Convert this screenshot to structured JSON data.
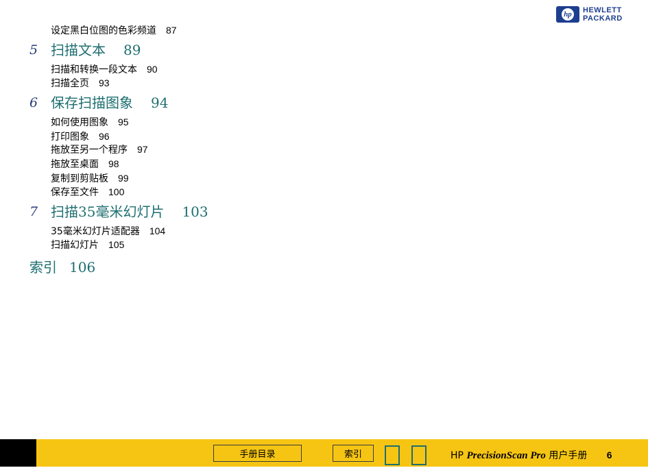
{
  "logo": {
    "line1": "HEWLETT",
    "line2": "PACKARD",
    "mark": "hp"
  },
  "toc": {
    "top_item": {
      "label": "设定黑白位图的色彩频道",
      "page": "87"
    },
    "chapters": [
      {
        "number": "5",
        "title": "扫描文本",
        "page": "89",
        "items": [
          {
            "label": "扫描和转换一段文本",
            "page": "90"
          },
          {
            "label": "扫描全页",
            "page": "93"
          }
        ]
      },
      {
        "number": "6",
        "title": "保存扫描图象",
        "page": "94",
        "items": [
          {
            "label": "如何使用图象",
            "page": "95"
          },
          {
            "label": "打印图象",
            "page": "96"
          },
          {
            "label": "拖放至另一个程序",
            "page": "97"
          },
          {
            "label": "拖放至桌面",
            "page": "98"
          },
          {
            "label": "复制到剪贴板",
            "page": "99"
          },
          {
            "label": "保存至文件",
            "page": "100"
          }
        ]
      },
      {
        "number": "7",
        "title": "扫描35毫米幻灯片",
        "page": "103",
        "items": [
          {
            "label": "35毫米幻灯片适配器",
            "page": "104"
          },
          {
            "label": "扫描幻灯片",
            "page": "105"
          }
        ]
      }
    ],
    "index": {
      "label": "索引",
      "page": "106"
    }
  },
  "footer": {
    "toc_button": "手册目录",
    "index_button": "索引",
    "prefix": "HP",
    "product": "PrecisionScan Pro",
    "suffix": "用户手册",
    "page_number": "6",
    "colors": {
      "bar": "#f6c514",
      "nav_square": "#1e6e70",
      "accent": "#1e6e70"
    }
  }
}
